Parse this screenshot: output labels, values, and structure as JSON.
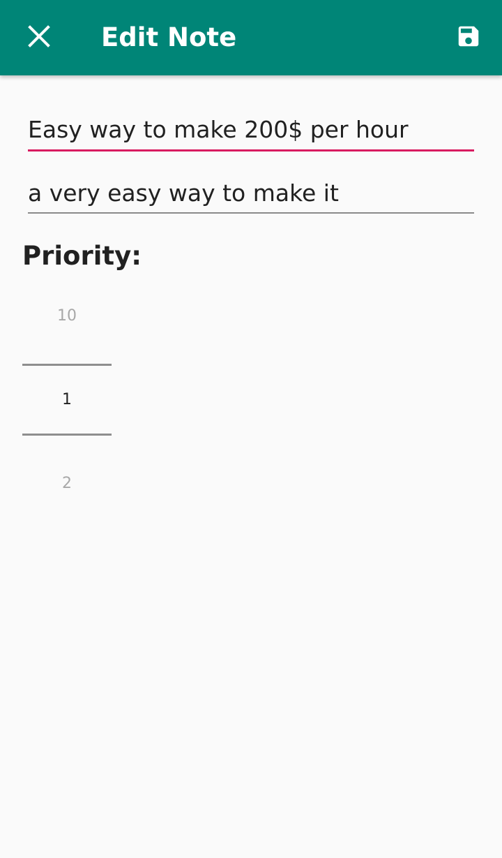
{
  "app_bar": {
    "close_icon": "close-icon",
    "title": "Edit Note",
    "save_icon": "save-icon",
    "background_color": "#008577"
  },
  "form": {
    "title_value": "Easy way to make 200$ per hour",
    "description_value": "a very easy way to make it",
    "focus_color": "#d81b60"
  },
  "priority": {
    "label": "Priority:",
    "picker": {
      "previous": "10",
      "selected": "1",
      "next": "2"
    }
  }
}
